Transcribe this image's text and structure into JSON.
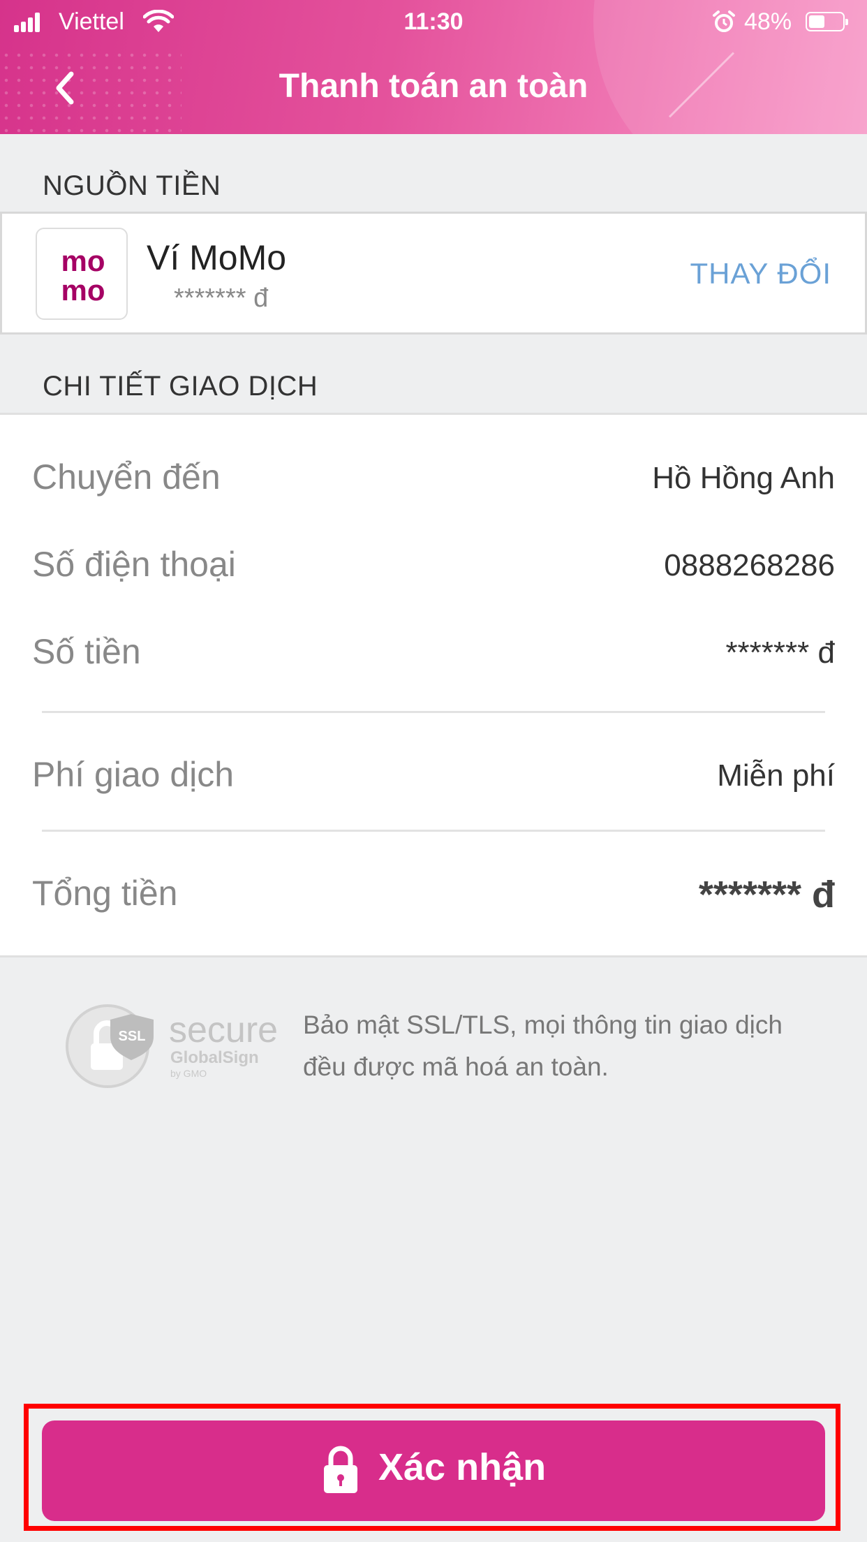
{
  "status_bar": {
    "carrier": "Viettel",
    "time": "11:30",
    "battery": "48%",
    "battery_level": 0.48
  },
  "header": {
    "title": "Thanh toán an toàn",
    "back_icon": "chevron-left-icon"
  },
  "source": {
    "section_title": "NGUỒN TIỀN",
    "logo_text_top": "mo",
    "logo_text_bottom": "mo",
    "wallet_name": "Ví MoMo",
    "balance": "******* đ",
    "change_label": "THAY ĐỔI"
  },
  "details": {
    "section_title": "CHI TIẾT GIAO DỊCH",
    "rows": [
      {
        "label": "Chuyển đến",
        "value": "Hồ Hồng Anh"
      },
      {
        "label": "Số điện thoại",
        "value": "0888268286"
      },
      {
        "label": "Số tiền",
        "value": "******* đ"
      },
      {
        "label": "Phí giao dịch",
        "value": "Miễn phí"
      },
      {
        "label": "Tổng tiền",
        "value": "******* đ"
      }
    ]
  },
  "secure": {
    "badge_ssl": "SSL",
    "badge_secure": "secure",
    "badge_brand": "GlobalSign",
    "badge_by": "by GMO",
    "text": "Bảo mật SSL/TLS, mọi thông tin giao dịch đều được mã hoá an toàn."
  },
  "confirm": {
    "label": "Xác nhận",
    "icon": "lock-icon"
  },
  "colors": {
    "brand": "#d82d8b",
    "link": "#6aa1d6",
    "highlight": "#ff0000"
  }
}
